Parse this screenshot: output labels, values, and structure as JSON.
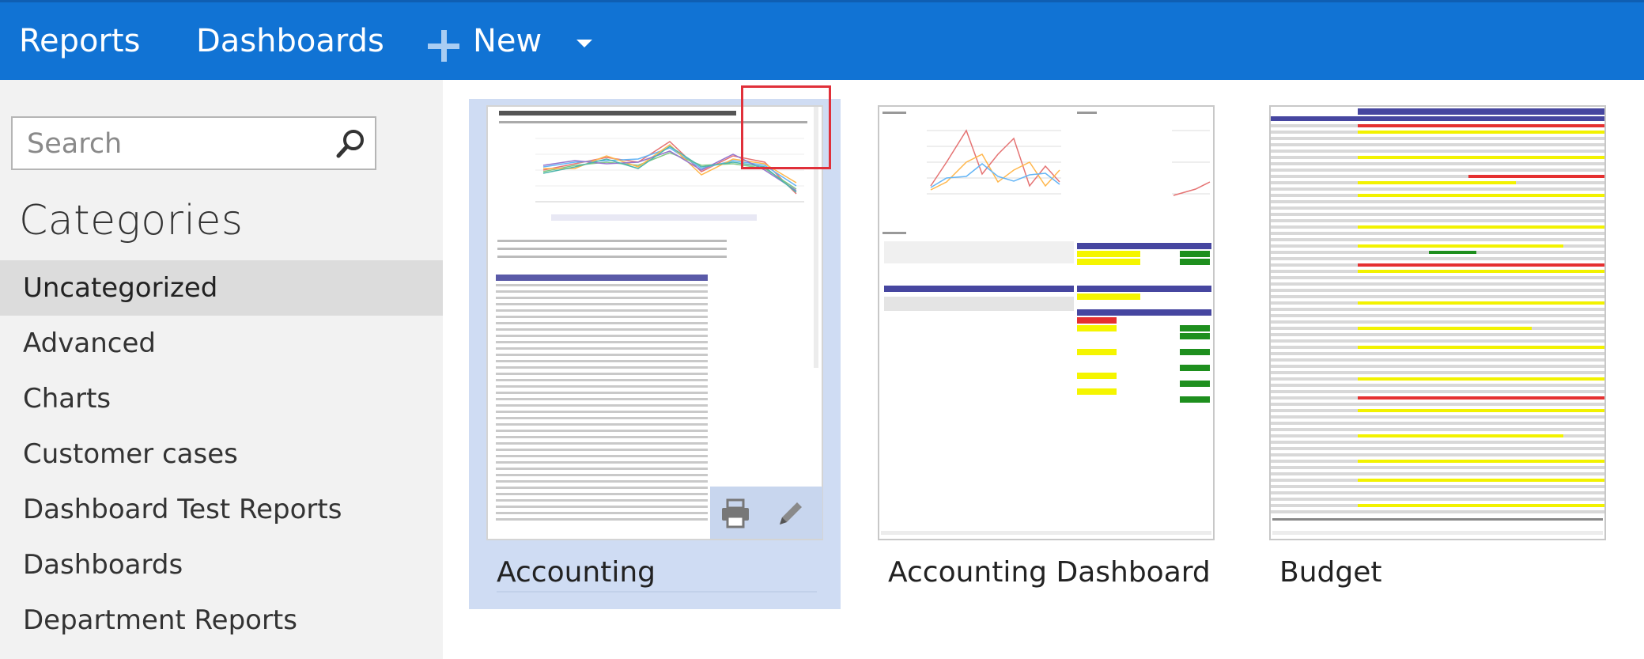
{
  "topbar": {
    "reports_label": "Reports",
    "dashboards_label": "Dashboards",
    "new_label": "New",
    "accent_color": "#1173d4"
  },
  "sidebar": {
    "search": {
      "placeholder": "Search",
      "value": ""
    },
    "categories_title": "Categories",
    "items": [
      {
        "label": "Uncategorized",
        "active": true
      },
      {
        "label": "Advanced"
      },
      {
        "label": "Charts"
      },
      {
        "label": "Customer cases"
      },
      {
        "label": "Dashboard Test Reports"
      },
      {
        "label": "Dashboards"
      },
      {
        "label": "Department Reports"
      }
    ]
  },
  "reports": [
    {
      "title": "Accounting",
      "selected": true,
      "actions": [
        "print-icon",
        "edit-icon"
      ]
    },
    {
      "title": "Accounting Dashboard"
    },
    {
      "title": "Budget"
    }
  ]
}
